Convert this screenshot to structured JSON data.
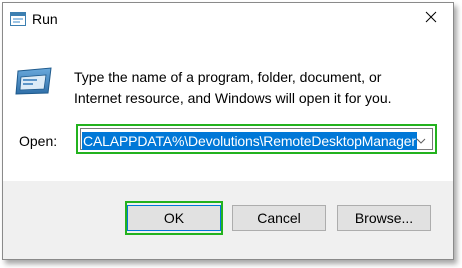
{
  "window": {
    "title": "Run",
    "app_icon": "run-icon",
    "close_icon": "close-icon"
  },
  "content": {
    "icon": "run-program-icon",
    "description": "Type the name of a program, folder, document, or\nInternet resource, and Windows will open it for you.",
    "open_label": "Open:",
    "open_value": "CALAPPDATA%\\Devolutions\\RemoteDesktopManager",
    "dropdown_icon": "chevron-down-icon"
  },
  "buttons": {
    "ok": "OK",
    "cancel": "Cancel",
    "browse": "Browse..."
  },
  "colors": {
    "highlight_green": "#23b21e",
    "selection_blue": "#0078d7",
    "footer_gray": "#f0f0f0"
  }
}
